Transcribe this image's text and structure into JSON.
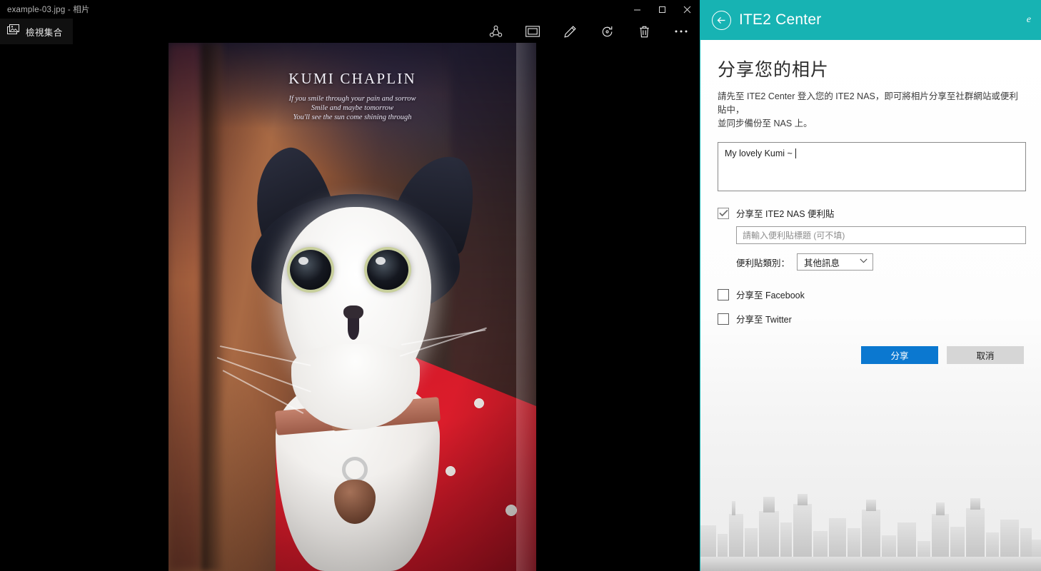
{
  "window": {
    "title": "example-03.jpg - 相片",
    "controls": {
      "minimize": "minimize-icon",
      "maximize": "maximize-icon",
      "close": "close-icon"
    }
  },
  "photos_toolbar": {
    "collection_label": "檢視集合",
    "collection_icon": "collection-icon",
    "actions": [
      {
        "name": "share",
        "icon": "share-icon"
      },
      {
        "name": "slideshow",
        "icon": "slideshow-icon"
      },
      {
        "name": "edit",
        "icon": "pencil-icon"
      },
      {
        "name": "rotate",
        "icon": "rotate-icon"
      },
      {
        "name": "delete",
        "icon": "trash-icon"
      },
      {
        "name": "more",
        "icon": "ellipsis-icon"
      }
    ]
  },
  "photo": {
    "overlay_title": "KUMI CHAPLIN",
    "overlay_line1": "If you smile through your pain and sorrow",
    "overlay_line2": "Smile and maybe tomorrow",
    "overlay_line3": "You'll see the sun come shining through"
  },
  "share_panel": {
    "header": {
      "back_icon": "back-arrow-icon",
      "title": "ITE2 Center",
      "logo_glyph": "e"
    },
    "heading": "分享您的相片",
    "description_line1": "請先至 ITE2 Center 登入您的 ITE2 NAS，即可將相片分享至社群網站或便利貼中，",
    "description_line2": "並同步備份至 NAS 上。",
    "message": {
      "value": "My lovely Kumi ~"
    },
    "nas_note": {
      "label": "分享至 ITE2 NAS 便利貼",
      "checked": true,
      "title_placeholder": "請輸入便利貼標題 (可不填)",
      "category_label": "便利貼類別：",
      "category_value": "其他訊息"
    },
    "facebook": {
      "label": "分享至 Facebook",
      "checked": false
    },
    "twitter": {
      "label": "分享至 Twitter",
      "checked": false
    },
    "buttons": {
      "share": "分享",
      "cancel": "取消"
    },
    "colors": {
      "header_teal": "#17b3b3",
      "primary_button": "#0b78d0",
      "secondary_button": "#d6d6d6"
    }
  }
}
